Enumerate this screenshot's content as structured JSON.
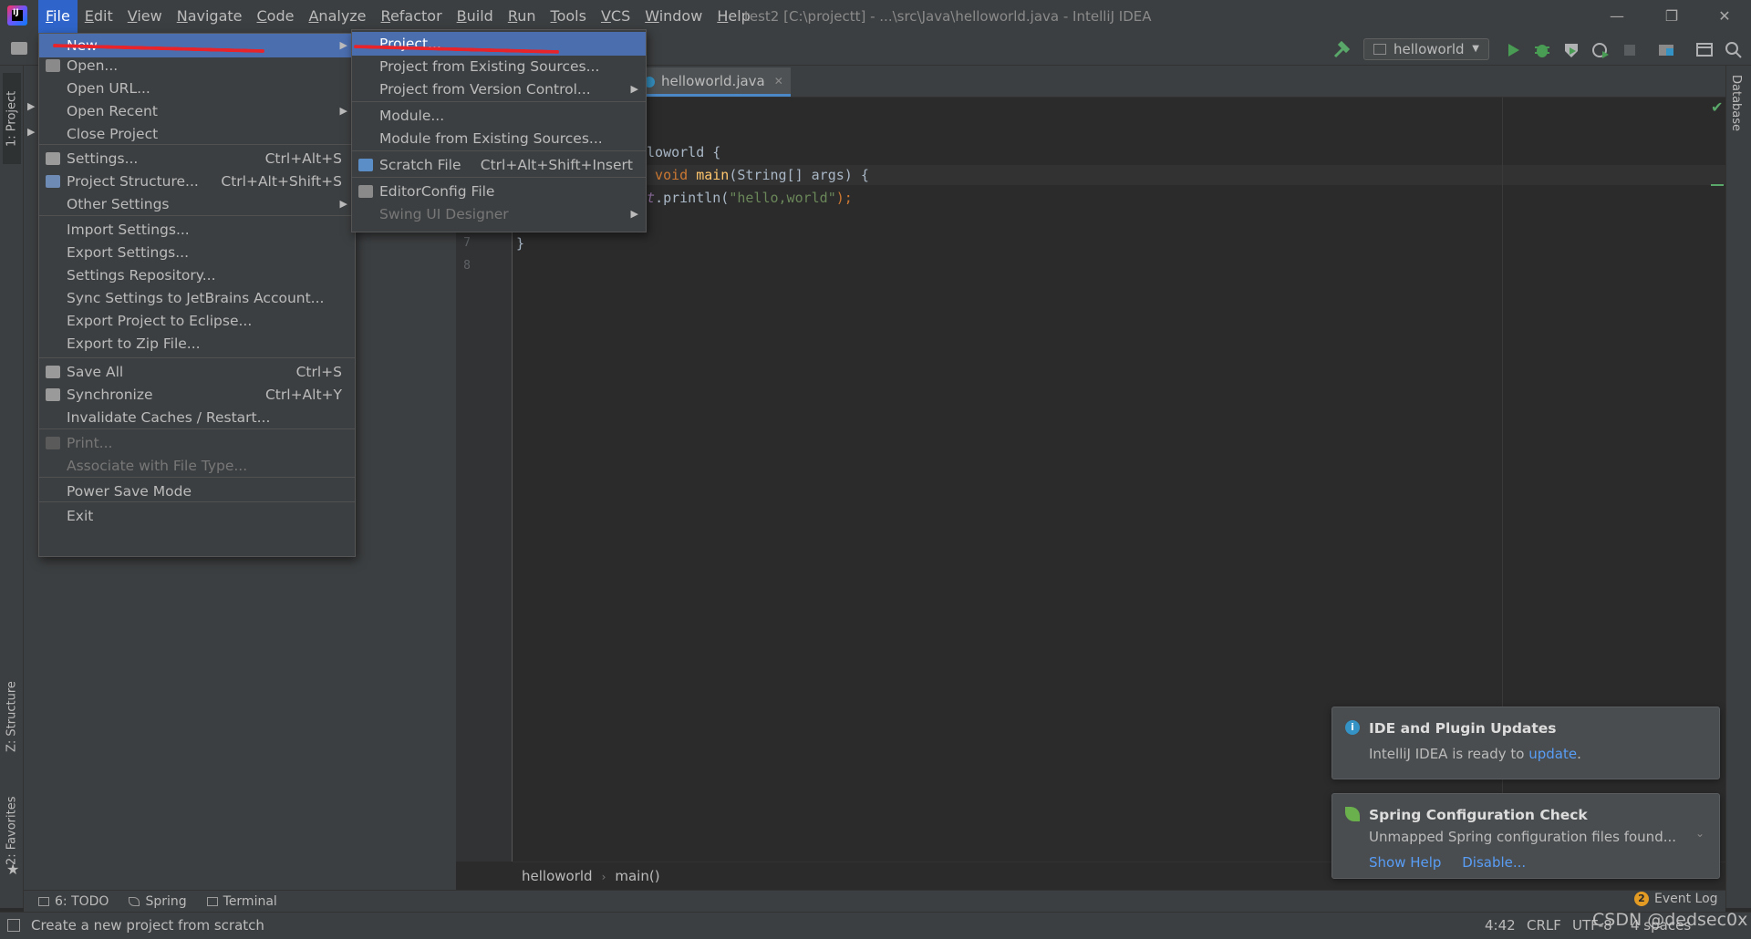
{
  "window": {
    "title": "test2 [C:\\projectt] - ...\\src\\Java\\helloworld.java - IntelliJ IDEA",
    "minimize": "—",
    "restore": "❐",
    "close": "✕"
  },
  "menubar": {
    "items": [
      "File",
      "Edit",
      "View",
      "Navigate",
      "Code",
      "Analyze",
      "Refactor",
      "Build",
      "Run",
      "Tools",
      "VCS",
      "Window",
      "Help"
    ]
  },
  "toolbar": {
    "run_config": "helloworld"
  },
  "left_stripe": {
    "project_tab": "1: Project",
    "structure_tab": "Z: Structure",
    "favorites_tab": "2: Favorites"
  },
  "right_stripe": {
    "database_tab": "Database"
  },
  "editor": {
    "tab_label": "helloworld.java",
    "line_numbers": [
      "7",
      "8"
    ],
    "code": {
      "line3_a": "lloworld {",
      "line4_kw": "c void ",
      "line4_fn": "main",
      "line4_rest": "(String[] args) {",
      "line5_fld": "ut",
      "line5_rest": ".println(",
      "line5_str": "\"hello,world\"",
      "line5_end": ");",
      "line7": "}"
    },
    "breadcrumbs": [
      "helloworld",
      "main()"
    ]
  },
  "file_menu": {
    "items": [
      {
        "label": "New",
        "shortcut": "",
        "submenu": true,
        "selected": true,
        "disabled": false
      },
      {
        "label": "Open...",
        "shortcut": "",
        "submenu": false,
        "disabled": false
      },
      {
        "label": "Open URL...",
        "shortcut": "",
        "submenu": false,
        "disabled": false
      },
      {
        "label": "Open Recent",
        "shortcut": "",
        "submenu": true,
        "disabled": false
      },
      {
        "label": "Close Project",
        "shortcut": "",
        "submenu": false,
        "disabled": false
      },
      {
        "label": "Settings...",
        "shortcut": "Ctrl+Alt+S",
        "submenu": false,
        "disabled": false
      },
      {
        "label": "Project Structure...",
        "shortcut": "Ctrl+Alt+Shift+S",
        "submenu": false,
        "disabled": false
      },
      {
        "label": "Other Settings",
        "shortcut": "",
        "submenu": true,
        "disabled": false
      },
      {
        "label": "Import Settings...",
        "shortcut": "",
        "submenu": false,
        "disabled": false
      },
      {
        "label": "Export Settings...",
        "shortcut": "",
        "submenu": false,
        "disabled": false
      },
      {
        "label": "Settings Repository...",
        "shortcut": "",
        "submenu": false,
        "disabled": false
      },
      {
        "label": "Sync Settings to JetBrains Account...",
        "shortcut": "",
        "submenu": false,
        "disabled": false
      },
      {
        "label": "Export Project to Eclipse...",
        "shortcut": "",
        "submenu": false,
        "disabled": false
      },
      {
        "label": "Export to Zip File...",
        "shortcut": "",
        "submenu": false,
        "disabled": false
      },
      {
        "label": "Save All",
        "shortcut": "Ctrl+S",
        "submenu": false,
        "disabled": false
      },
      {
        "label": "Synchronize",
        "shortcut": "Ctrl+Alt+Y",
        "submenu": false,
        "disabled": false
      },
      {
        "label": "Invalidate Caches / Restart...",
        "shortcut": "",
        "submenu": false,
        "disabled": false
      },
      {
        "label": "Print...",
        "shortcut": "",
        "submenu": false,
        "disabled": true
      },
      {
        "label": "Associate with File Type...",
        "shortcut": "",
        "submenu": false,
        "disabled": true
      },
      {
        "label": "Power Save Mode",
        "shortcut": "",
        "submenu": false,
        "disabled": false
      },
      {
        "label": "Exit",
        "shortcut": "",
        "submenu": false,
        "disabled": false
      }
    ]
  },
  "new_menu": {
    "items": [
      {
        "label": "Project...",
        "shortcut": "",
        "submenu": false,
        "selected": true,
        "disabled": false
      },
      {
        "label": "Project from Existing Sources...",
        "shortcut": "",
        "submenu": false,
        "disabled": false
      },
      {
        "label": "Project from Version Control...",
        "shortcut": "",
        "submenu": true,
        "disabled": false
      },
      {
        "label": "Module...",
        "shortcut": "",
        "submenu": false,
        "disabled": false
      },
      {
        "label": "Module from Existing Sources...",
        "shortcut": "",
        "submenu": false,
        "disabled": false
      },
      {
        "label": "Scratch File",
        "shortcut": "Ctrl+Alt+Shift+Insert",
        "submenu": false,
        "disabled": false
      },
      {
        "label": "EditorConfig File",
        "shortcut": "",
        "submenu": false,
        "disabled": false
      },
      {
        "label": "Swing UI Designer",
        "shortcut": "",
        "submenu": true,
        "disabled": true
      }
    ]
  },
  "notifications": {
    "updates": {
      "title": "IDE and Plugin Updates",
      "body": "IntelliJ IDEA is ready to ",
      "link": "update",
      "tail": "."
    },
    "spring": {
      "title": "Spring Configuration Check",
      "body": "Unmapped Spring configuration files found...",
      "show_help": "Show Help",
      "disable": "Disable..."
    }
  },
  "bottom_tools": {
    "todo": "6: TODO",
    "spring": "Spring",
    "terminal": "Terminal",
    "event_log": "Event Log",
    "event_count": "2"
  },
  "statusbar": {
    "message": "Create a new project from scratch",
    "position": "4:42",
    "line_sep": "CRLF",
    "encoding": "UTF-8",
    "indent": "4 spaces",
    "watermark": "CSDN @dedsec0x"
  },
  "colors": {
    "accent": "#4b6eaf",
    "annotation_red": "#e8232a",
    "background": "#2b2b2b"
  }
}
